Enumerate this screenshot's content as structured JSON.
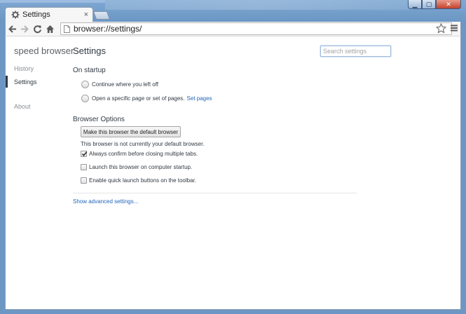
{
  "window": {
    "controls": {
      "minimize": "▁",
      "maximize": "▢",
      "close": "✕"
    }
  },
  "tab": {
    "title": "Settings",
    "close": "×",
    "icon": "gear-icon"
  },
  "toolbar": {
    "back_icon": "back-arrow-icon",
    "forward_icon": "forward-arrow-icon",
    "reload_icon": "reload-icon",
    "home_icon": "home-icon",
    "url": "browser://settings/",
    "star_icon": "star-icon",
    "menu_icon": "hamburger-menu-icon"
  },
  "sidebar": {
    "brand": "speed browser",
    "items": [
      {
        "label": "History"
      },
      {
        "label": "Settings"
      },
      {
        "label": "About"
      }
    ]
  },
  "main": {
    "title": "Settings",
    "search_placeholder": "Search settings",
    "startup": {
      "title": "On startup",
      "option1": "Continue where you left off",
      "option2": "Open a specific page or set of pages.",
      "option2_link": "Set pages"
    },
    "browser_options": {
      "title": "Browser Options",
      "default_button": "Make this browser the default browser",
      "status": "This browser is not currently your default browser.",
      "checkbox1": {
        "label": "Always confirm before closing multiple tabs.",
        "checked": true
      },
      "checkbox2": {
        "label": "Launch this browser on computer startup.",
        "checked": false
      },
      "checkbox3": {
        "label": "Enable quick launch buttons on the toolbar.",
        "checked": false
      }
    },
    "advanced_link": "Show advanced settings..."
  },
  "colors": {
    "accent_link": "#2466b8",
    "text": "#303942",
    "frame": "#6f9ec9"
  }
}
